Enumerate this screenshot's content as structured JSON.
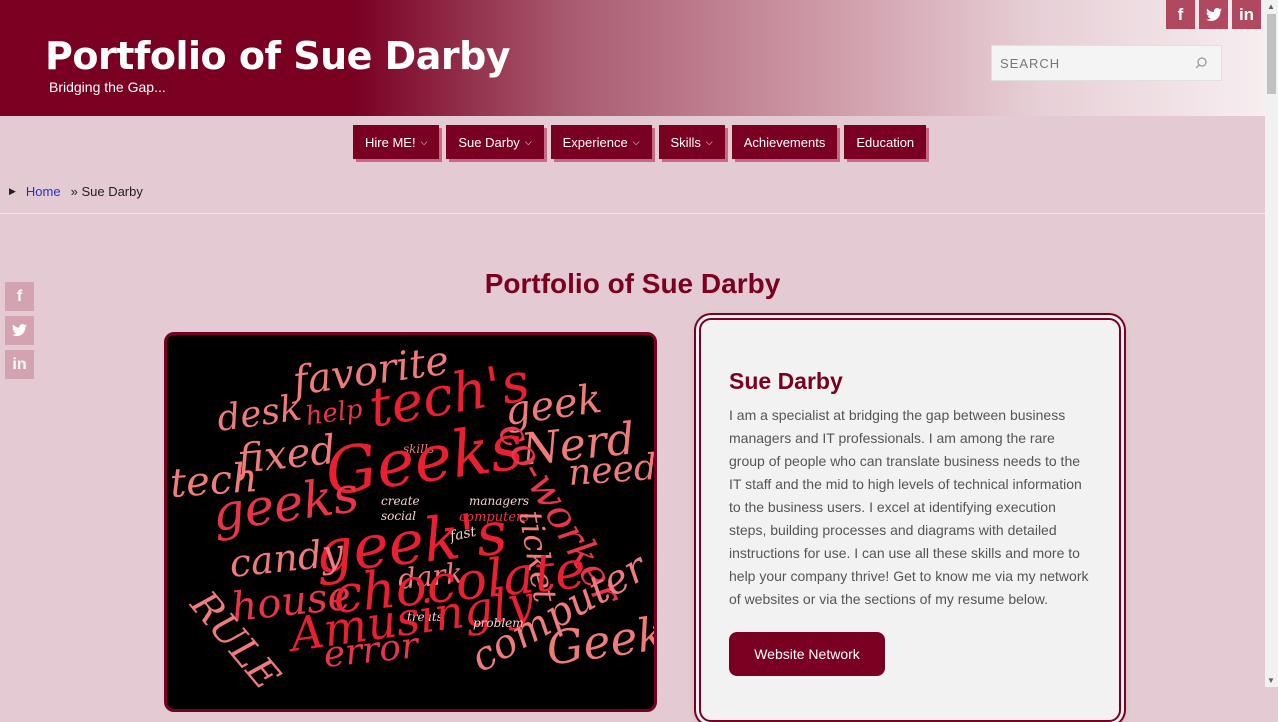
{
  "site": {
    "title": "Portfolio of Sue Darby",
    "tagline": "Bridging the Gap..."
  },
  "search": {
    "placeholder": "SEARCH"
  },
  "social": {
    "facebook": "f",
    "twitter": "t",
    "linkedin": "in"
  },
  "nav": [
    {
      "label": "Hire ME!",
      "dropdown": true
    },
    {
      "label": "Sue Darby",
      "dropdown": true
    },
    {
      "label": "Experience",
      "dropdown": true
    },
    {
      "label": "Skills",
      "dropdown": true
    },
    {
      "label": "Achievements",
      "dropdown": false
    },
    {
      "label": "Education",
      "dropdown": false
    }
  ],
  "breadcrumb": {
    "home": "Home",
    "current": "» Sue Darby"
  },
  "main": {
    "title": "Portfolio of Sue Darby"
  },
  "word_cloud": {
    "words": [
      "favorite",
      "desk",
      "help",
      "tech's",
      "geek",
      "Nerd",
      "need",
      "fixed",
      "skills",
      "Geeks",
      "tech",
      "geeks",
      "create",
      "managers",
      "social",
      "computers",
      "geek's",
      "fast",
      "ticket",
      "co-worker",
      "candy",
      "dark",
      "house",
      "chocolate",
      "treats",
      "RULE",
      "Amusingly",
      "problem",
      "computer",
      "error",
      "Geek"
    ]
  },
  "card": {
    "heading": "Sue Darby",
    "body": "I am a specialist at bridging the gap between business managers and IT professionals. I am among the rare group of people who can translate business needs to the IT staff and the mid to high levels of technical information to the business users. I excel at identifying execution steps, building processes and diagrams with detailed instructions for use. I can use all these skills and more to help your company thrive! Get to know me via my network of websites or via the sections of my resume below.",
    "button": "Website Network"
  },
  "colors": {
    "brand": "#7a0022",
    "background": "#e4cbd3",
    "card": "#f2f2f2"
  }
}
